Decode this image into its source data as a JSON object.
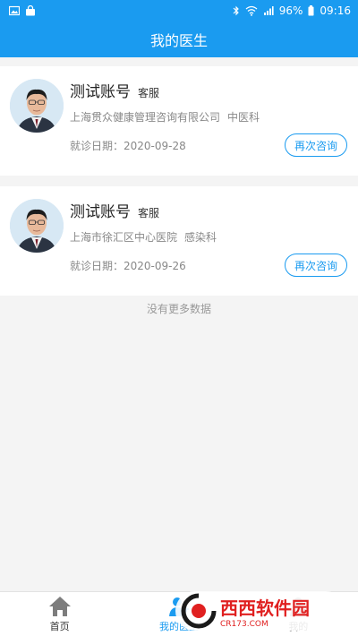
{
  "status_bar": {
    "battery": "96%",
    "time": "09:16"
  },
  "header": {
    "title": "我的医生"
  },
  "doctors": [
    {
      "name": "测试账号",
      "title": "客服",
      "hospital": "上海贯众健康管理咨询有限公司",
      "department": "中医科",
      "visit_date": "就诊日期：2020-09-28",
      "button": "再次咨询"
    },
    {
      "name": "测试账号",
      "title": "客服",
      "hospital": "上海市徐汇区中心医院",
      "department": "感染科",
      "visit_date": "就诊日期：2020-09-26",
      "button": "再次咨询"
    }
  ],
  "list_footer": "没有更多数据",
  "tabs": [
    {
      "label": "首页",
      "icon": "home-icon"
    },
    {
      "label": "我的医生",
      "icon": "doctor-icon",
      "active": true
    },
    {
      "label": "我的",
      "icon": "user-icon"
    }
  ],
  "watermark": {
    "brand": "西西软件园",
    "url": "CR173.COM"
  },
  "colors": {
    "primary": "#1a9bf0",
    "background": "#f4f4f4"
  }
}
